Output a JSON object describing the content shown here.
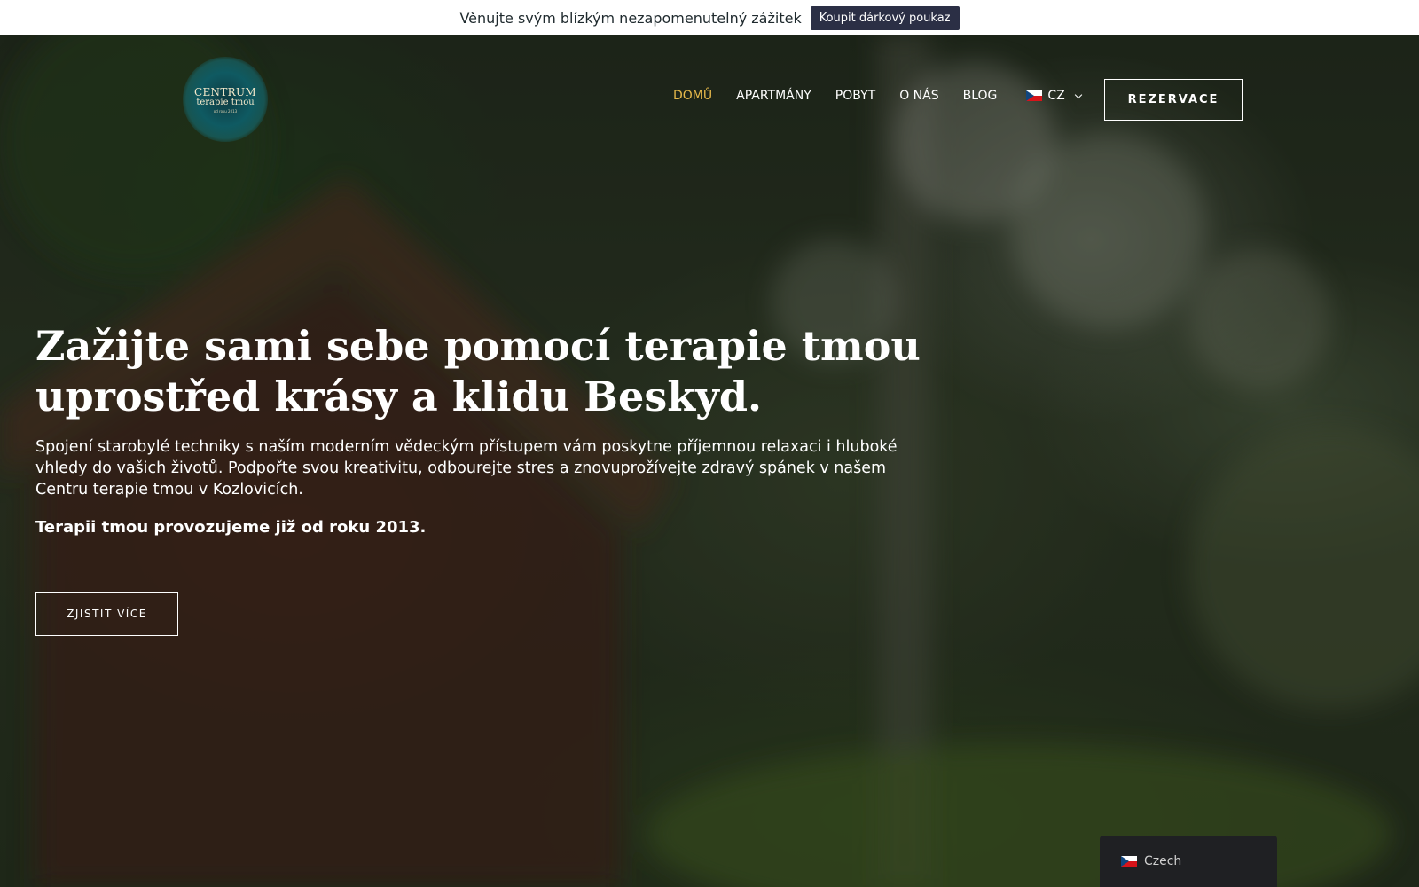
{
  "announcement": {
    "text": "Věnujte svým blízkým nezapomenutelný zážitek",
    "button_label": "Koupit dárkový poukaz"
  },
  "logo": {
    "line1": "CENTRUM",
    "line2": "terapie tmou",
    "line3": "od roku 2013",
    "colors": {
      "bg": "#0f5a62",
      "text": "#f1e7c9"
    }
  },
  "nav": {
    "items": [
      {
        "label": "DOMŮ",
        "active": true
      },
      {
        "label": "APARTMÁNY",
        "active": false
      },
      {
        "label": "POBYT",
        "active": false
      },
      {
        "label": "O NÁS",
        "active": false
      },
      {
        "label": "BLOG",
        "active": false
      }
    ],
    "language": {
      "label": "CZ",
      "icon": "czech-flag-icon"
    },
    "reserve_label": "REZERVACE",
    "active_color": "#e5b84a"
  },
  "hero": {
    "title": "Zažijte sami sebe pomocí terapie tmou uprostřed krásy a klidu Beskyd.",
    "description": "Spojení starobylé techniky s naším moderním vědeckým přístupem vám poskytne příjemnou relaxaci i hluboké vhledy do vašich životů. Podpořte svou kreativitu, odbourejte stres a znovuprožívejte zdravý spánek v našem Centru terapie tmou v Kozlovicích.",
    "since": "Terapii tmou provozujeme již od roku 2013.",
    "cta_label": "ZJISTIT VÍCE"
  },
  "language_switcher": {
    "label": "Czech",
    "icon": "czech-flag-icon"
  }
}
